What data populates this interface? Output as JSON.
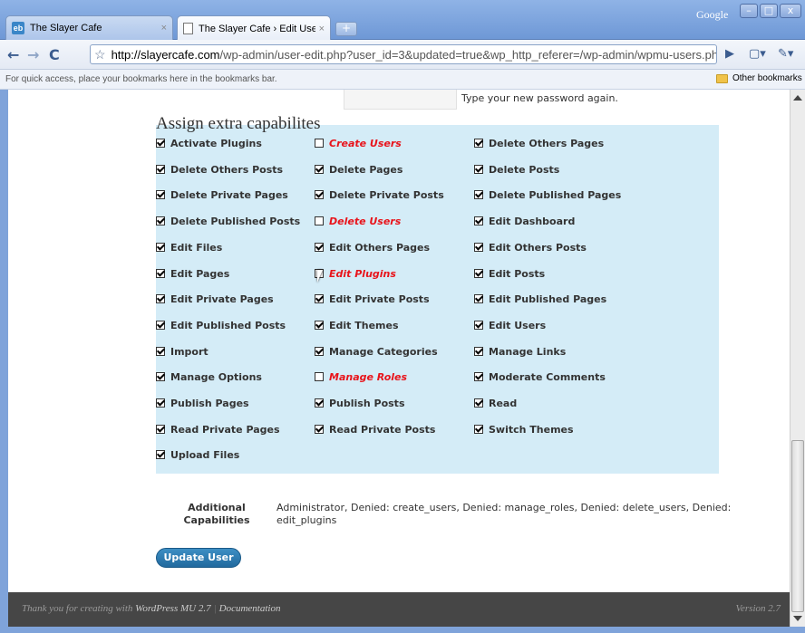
{
  "browser": {
    "tabs": [
      {
        "title": "The Slayer Cafe",
        "close": "×"
      },
      {
        "title": "The Slayer Cafe › Edit User…",
        "close": "×"
      }
    ],
    "new_tab": "+",
    "search_label": "Google",
    "window_controls": {
      "minimize": "–",
      "maximize": "□",
      "close": "x"
    },
    "url_domain": "http://slayercafe.com",
    "url_rest": "/wp-admin/user-edit.php?user_id=3&updated=true&wp_http_referer=/wp-admin/wpmu-users.php",
    "bookmarks_hint": "For quick access, place your bookmarks here in the bookmarks bar.",
    "other_bookmarks": "Other bookmarks",
    "icons": {
      "back": "back-arrow-icon",
      "forward": "forward-arrow-icon",
      "reload": "reload-icon",
      "star": "star-icon",
      "go": "go-arrow-icon",
      "page": "page-menu-icon",
      "wrench": "wrench-icon"
    }
  },
  "page": {
    "password_hint": "Type your new password again.",
    "section_title": "Assign extra capabilites",
    "capabilities": [
      {
        "label": "Activate Plugins",
        "checked": true,
        "denied": false
      },
      {
        "label": "Create Users",
        "checked": false,
        "denied": true
      },
      {
        "label": "Delete Others Pages",
        "checked": true,
        "denied": false
      },
      {
        "label": "Delete Others Posts",
        "checked": true,
        "denied": false
      },
      {
        "label": "Delete Pages",
        "checked": true,
        "denied": false
      },
      {
        "label": "Delete Posts",
        "checked": true,
        "denied": false
      },
      {
        "label": "Delete Private Pages",
        "checked": true,
        "denied": false
      },
      {
        "label": "Delete Private Posts",
        "checked": true,
        "denied": false
      },
      {
        "label": "Delete Published Pages",
        "checked": true,
        "denied": false
      },
      {
        "label": "Delete Published Posts",
        "checked": true,
        "denied": false
      },
      {
        "label": "Delete Users",
        "checked": false,
        "denied": true
      },
      {
        "label": "Edit Dashboard",
        "checked": true,
        "denied": false
      },
      {
        "label": "Edit Files",
        "checked": true,
        "denied": false
      },
      {
        "label": "Edit Others Pages",
        "checked": true,
        "denied": false
      },
      {
        "label": "Edit Others Posts",
        "checked": true,
        "denied": false
      },
      {
        "label": "Edit Pages",
        "checked": true,
        "denied": false
      },
      {
        "label": "Edit Plugins",
        "checked": false,
        "denied": true
      },
      {
        "label": "Edit Posts",
        "checked": true,
        "denied": false
      },
      {
        "label": "Edit Private Pages",
        "checked": true,
        "denied": false
      },
      {
        "label": "Edit Private Posts",
        "checked": true,
        "denied": false
      },
      {
        "label": "Edit Published Pages",
        "checked": true,
        "denied": false
      },
      {
        "label": "Edit Published Posts",
        "checked": true,
        "denied": false
      },
      {
        "label": "Edit Themes",
        "checked": true,
        "denied": false
      },
      {
        "label": "Edit Users",
        "checked": true,
        "denied": false
      },
      {
        "label": "Import",
        "checked": true,
        "denied": false
      },
      {
        "label": "Manage Categories",
        "checked": true,
        "denied": false
      },
      {
        "label": "Manage Links",
        "checked": true,
        "denied": false
      },
      {
        "label": "Manage Options",
        "checked": true,
        "denied": false
      },
      {
        "label": "Manage Roles",
        "checked": false,
        "denied": true
      },
      {
        "label": "Moderate Comments",
        "checked": true,
        "denied": false
      },
      {
        "label": "Publish Pages",
        "checked": true,
        "denied": false
      },
      {
        "label": "Publish Posts",
        "checked": true,
        "denied": false
      },
      {
        "label": "Read",
        "checked": true,
        "denied": false
      },
      {
        "label": "Read Private Pages",
        "checked": true,
        "denied": false
      },
      {
        "label": "Read Private Posts",
        "checked": true,
        "denied": false
      },
      {
        "label": "Switch Themes",
        "checked": true,
        "denied": false
      },
      {
        "label": "Upload Files",
        "checked": true,
        "denied": false
      }
    ],
    "additional_label_line1": "Additional",
    "additional_label_line2": "Capabilities",
    "additional_value": "Administrator, Denied: create_users, Denied: manage_roles, Denied: delete_users, Denied: edit_plugins",
    "update_button": "Update User"
  },
  "footer": {
    "thanks_prefix": "Thank you for creating with",
    "product": "WordPress MU 2.7",
    "separator": "|",
    "documentation": "Documentation",
    "version": "Version 2.7"
  },
  "colors": {
    "denied": "#e8141b",
    "panel": "#d4ecf7",
    "button": "#21699e",
    "footer": "#464646"
  }
}
